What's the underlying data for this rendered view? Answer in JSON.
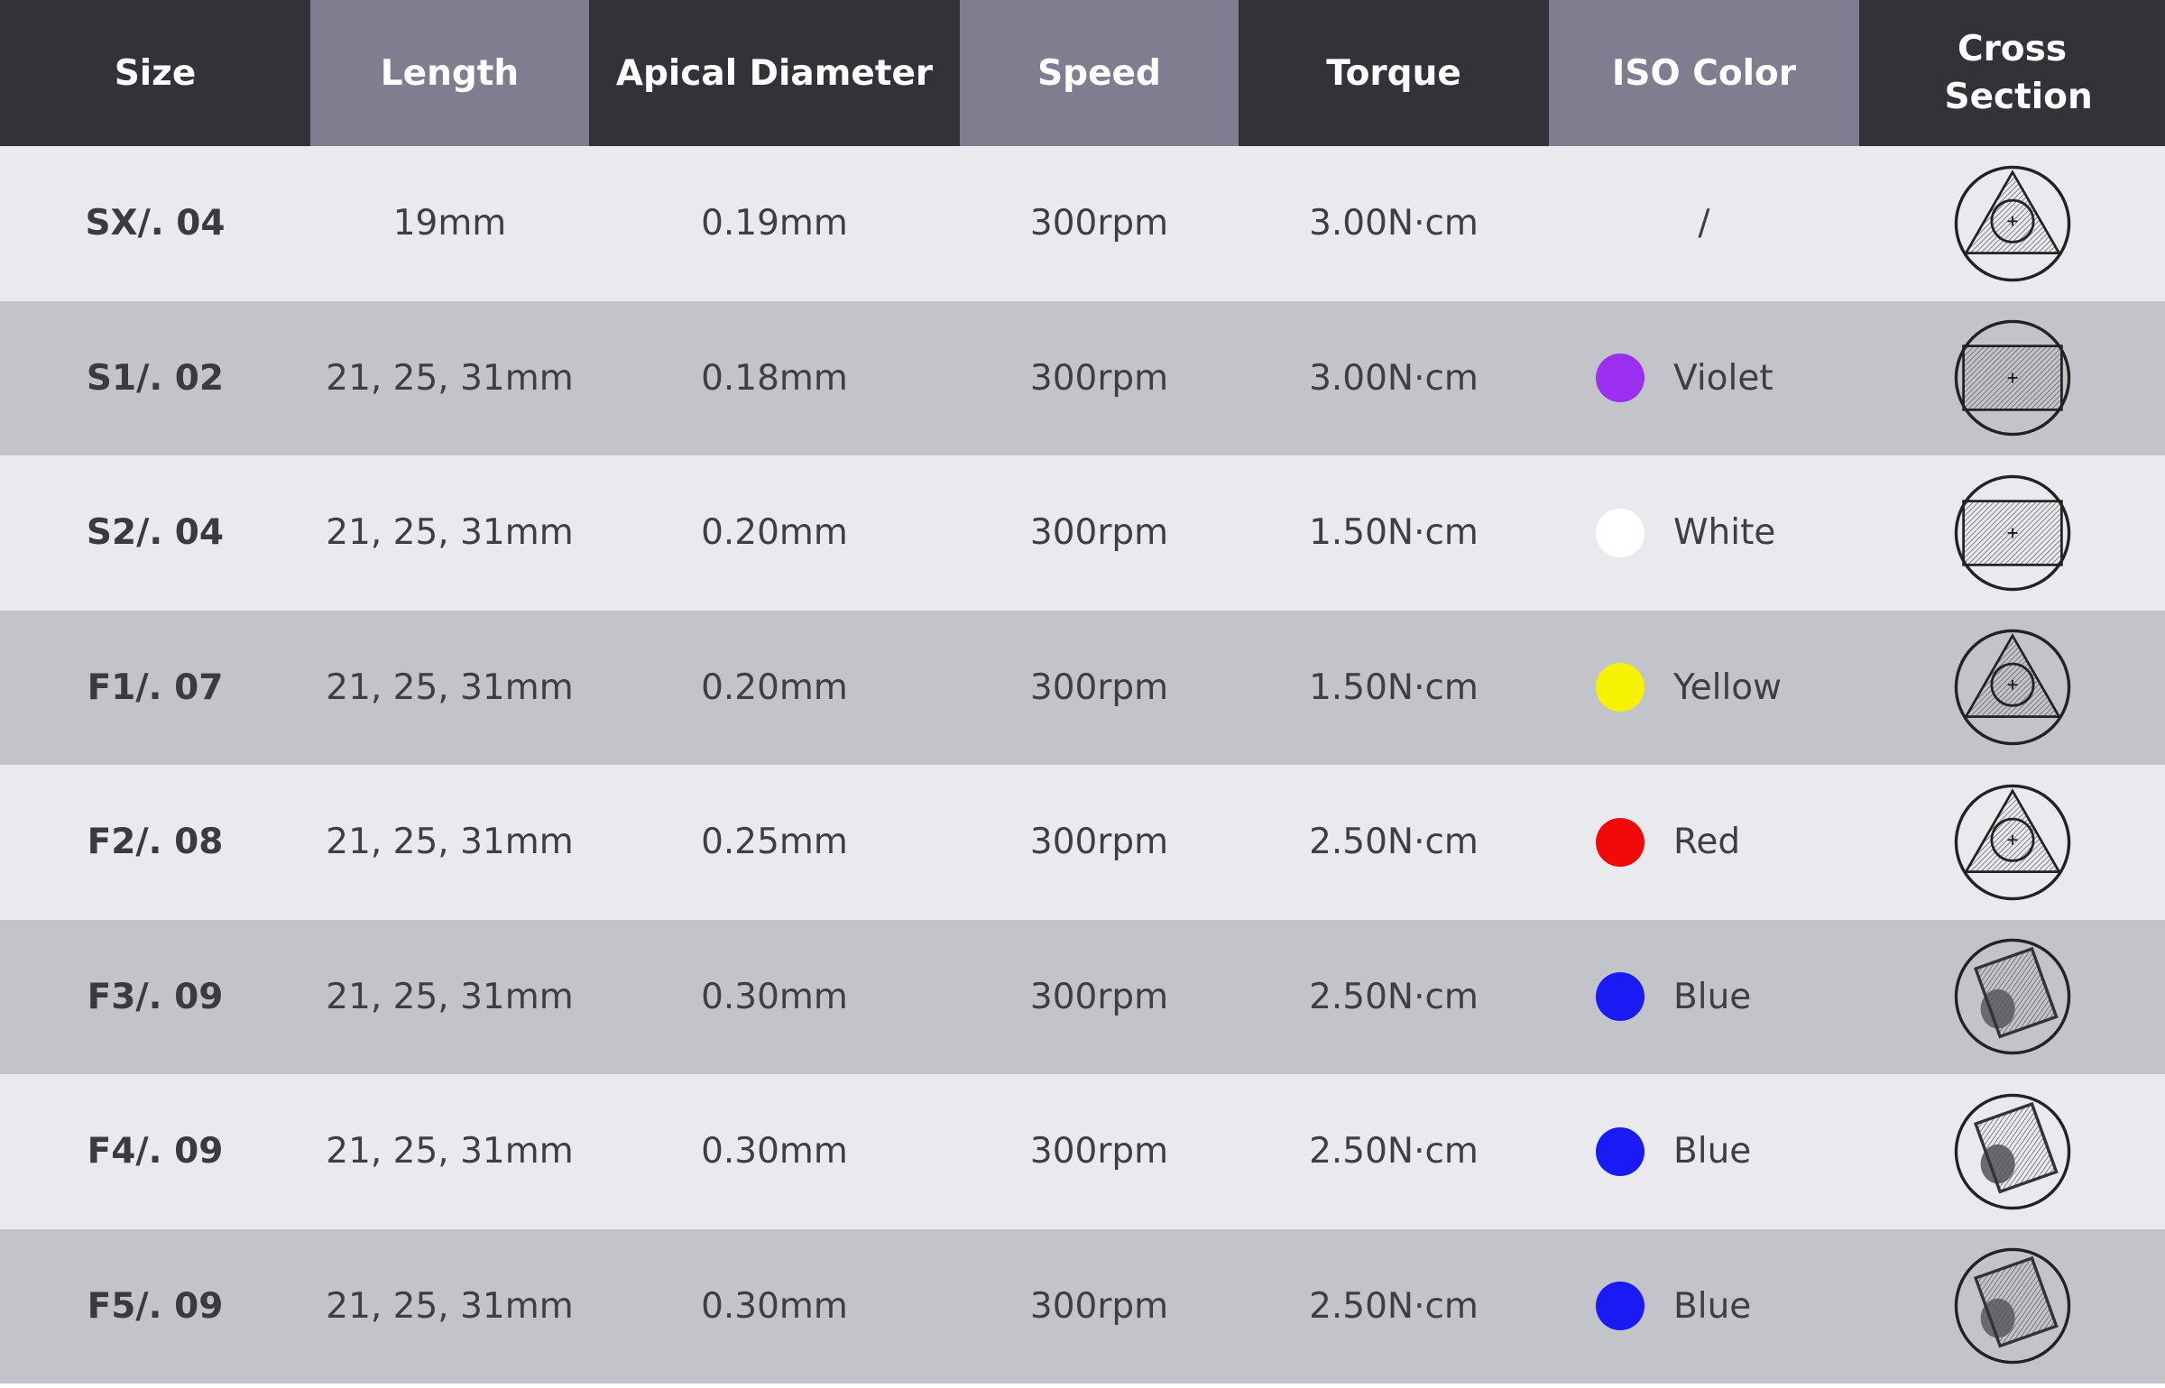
{
  "headers": [
    "Size",
    "Length",
    "Apical Diameter",
    "Speed",
    "Torque",
    "ISO Color",
    "Cross Section"
  ],
  "rows": [
    {
      "size": "SX/. 04",
      "length": "19mm",
      "apical": "0.19mm",
      "speed": "300rpm",
      "torque": "3.00N·cm",
      "iso_name": "/",
      "iso_color": "",
      "cross_section": "triangle"
    },
    {
      "size": "S1/. 02",
      "length": "21, 25, 31mm",
      "apical": "0.18mm",
      "speed": "300rpm",
      "torque": "3.00N·cm",
      "iso_name": "Violet",
      "iso_color": "#9b30f0",
      "cross_section": "rectangle"
    },
    {
      "size": "S2/. 04",
      "length": "21, 25, 31mm",
      "apical": "0.20mm",
      "speed": "300rpm",
      "torque": "1.50N·cm",
      "iso_name": "White",
      "iso_color": "#ffffff",
      "cross_section": "rectangle"
    },
    {
      "size": "F1/. 07",
      "length": "21, 25, 31mm",
      "apical": "0.20mm",
      "speed": "300rpm",
      "torque": "1.50N·cm",
      "iso_name": "Yellow",
      "iso_color": "#f7f300",
      "cross_section": "triangle"
    },
    {
      "size": "F2/. 08",
      "length": "21, 25, 31mm",
      "apical": "0.25mm",
      "speed": "300rpm",
      "torque": "2.50N·cm",
      "iso_name": "Red",
      "iso_color": "#f00a0a",
      "cross_section": "triangle"
    },
    {
      "size": "F3/. 09",
      "length": "21, 25, 31mm",
      "apical": "0.30mm",
      "speed": "300rpm",
      "torque": "2.50N·cm",
      "iso_name": "Blue",
      "iso_color": "#1a1af5",
      "cross_section": "tilted-square"
    },
    {
      "size": "F4/. 09",
      "length": "21, 25, 31mm",
      "apical": "0.30mm",
      "speed": "300rpm",
      "torque": "2.50N·cm",
      "iso_name": "Blue",
      "iso_color": "#1a1af5",
      "cross_section": "tilted-square"
    },
    {
      "size": "F5/. 09",
      "length": "21, 25, 31mm",
      "apical": "0.30mm",
      "speed": "300rpm",
      "torque": "2.50N·cm",
      "iso_name": "Blue",
      "iso_color": "#1a1af5",
      "cross_section": "tilted-square"
    }
  ]
}
